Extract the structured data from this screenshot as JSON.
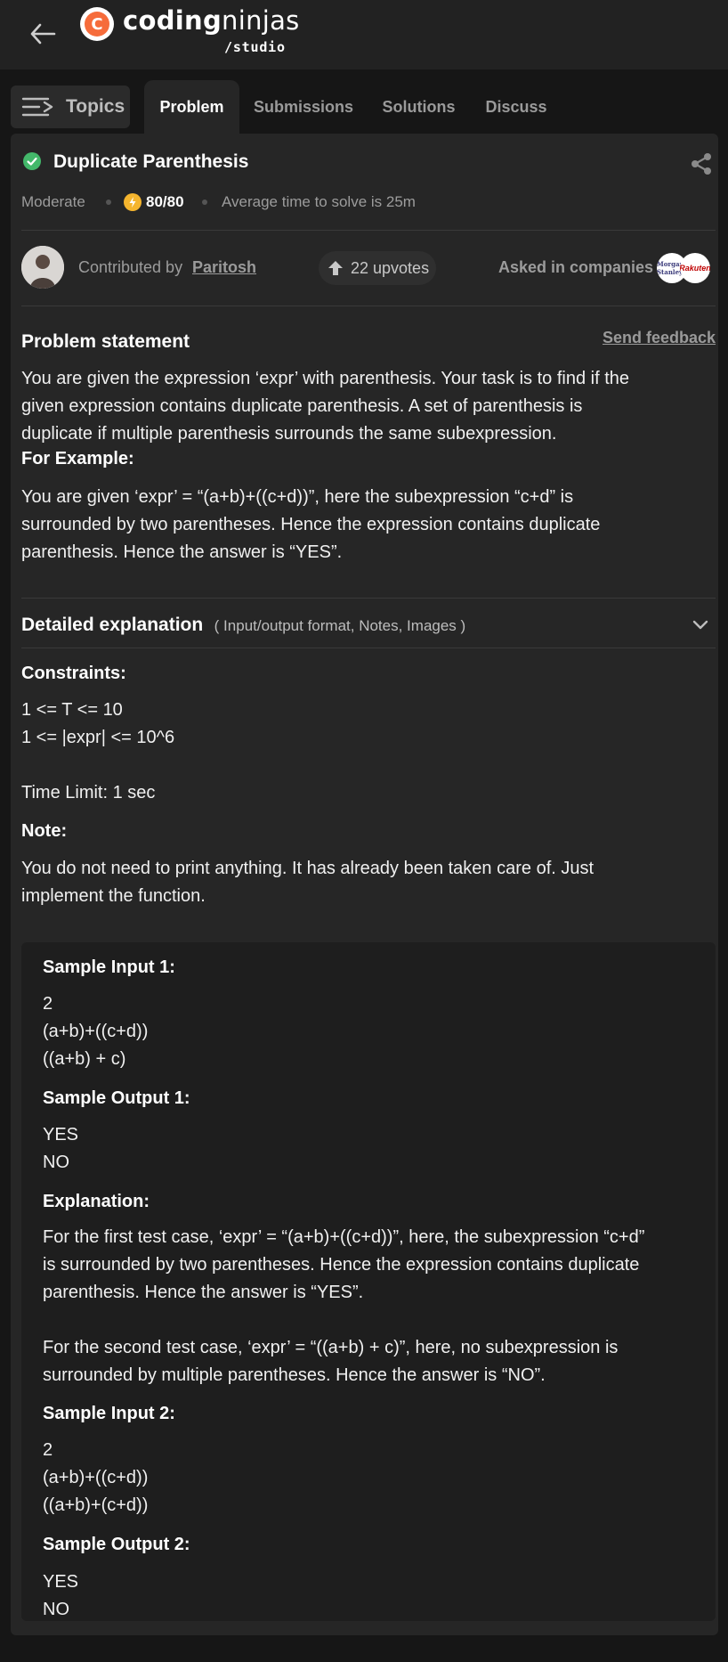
{
  "header": {
    "logo_mark": "C",
    "logo_coding": "coding",
    "logo_ninjas": "ninjas",
    "logo_studio": "/studio"
  },
  "tabs": {
    "topics": "Topics",
    "items": [
      "Problem",
      "Submissions",
      "Solutions",
      "Discuss"
    ],
    "active": "Problem"
  },
  "problem": {
    "title": "Duplicate Parenthesis",
    "difficulty": "Moderate",
    "score": "80/80",
    "avg_time": "Average time to solve is 25m",
    "contributed_prefix": "Contributed by",
    "contributor": "Paritosh",
    "upvotes": "22 upvotes",
    "asked_in": "Asked in companies",
    "companies": [
      "Morgan Stanley",
      "Rakuten"
    ]
  },
  "statement": {
    "heading": "Problem statement",
    "send_feedback": "Send feedback",
    "lines": [
      "You are given the expression ‘expr’ with parenthesis. Your task is to find if the",
      "given expression contains duplicate parenthesis. A set of parenthesis is",
      "duplicate if multiple parenthesis surrounds the same subexpression."
    ],
    "example_heading": "For Example:",
    "example_lines": [
      "You are given ‘expr’ = “(a+b)+((c+d))”, here the subexpression “c+d” is",
      "surrounded by two parentheses. Hence the expression contains duplicate",
      "parenthesis. Hence the answer is “YES”."
    ]
  },
  "detailed": {
    "heading": "Detailed explanation",
    "sub": "( Input/output format, Notes, Images )"
  },
  "constraints": {
    "heading": "Constraints:",
    "lines": [
      "1 <= T <= 10",
      "1 <= |expr| <= 10^6"
    ],
    "time_limit": "Time Limit: 1 sec"
  },
  "note": {
    "heading": "Note:",
    "lines": [
      "You do not need to print anything. It has already been taken care of. Just",
      "implement the function."
    ]
  },
  "samples": {
    "input1_heading": "Sample Input 1:",
    "input1": [
      "2",
      "(a+b)+((c+d))",
      "((a+b) + c)"
    ],
    "output1_heading": "Sample Output 1:",
    "output1": [
      "YES",
      "NO"
    ],
    "explanation_heading": "Explanation:",
    "explanation1": [
      "For the first test case,  ‘expr’ = “(a+b)+((c+d))”, here, the subexpression “c+d”",
      "is surrounded by two parentheses. Hence the expression contains duplicate",
      "parenthesis. Hence the answer is “YES”."
    ],
    "explanation2": [
      "For the second test case, ‘expr’ = “((a+b) + c)”, here, no subexpression is",
      "surrounded by multiple parentheses. Hence the answer is “NO”."
    ],
    "input2_heading": "Sample Input 2:",
    "input2": [
      "2",
      "(a+b)+((c+d))",
      "((a+b)+(c+d))"
    ],
    "output2_heading": "Sample Output 2:",
    "output2": [
      "YES",
      "NO"
    ]
  },
  "colors": {
    "accent_green": "#43b86a",
    "score_yellow": "#f5b52e",
    "logo_orange": "#f66c3b"
  }
}
